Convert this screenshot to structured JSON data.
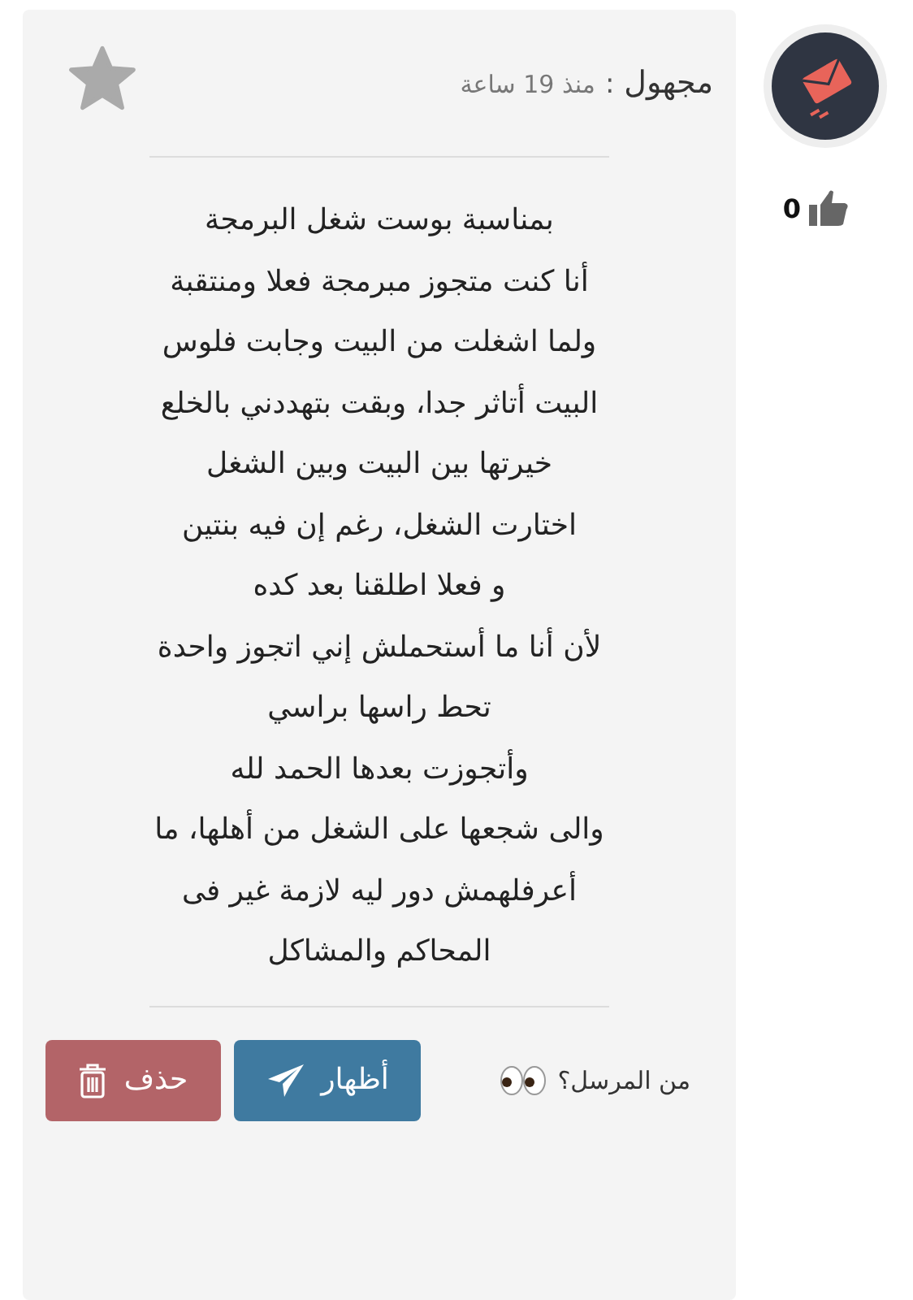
{
  "author": {
    "name": "مجهول",
    "separator": ":",
    "time": "منذ 19 ساعة"
  },
  "likes": {
    "count": "0"
  },
  "message": {
    "lines": [
      "بمناسبة بوست شغل البرمجة",
      "أنا كنت متجوز مبرمجة فعلا ومنتقبة",
      "ولما اشغلت من البيت وجابت فلوس",
      "البيت أتاثر جدا، وبقت بتهددني بالخلع",
      "خيرتها بين البيت وبين الشغل",
      "اختارت الشغل، رغم إن فيه بنتين",
      "و فعلا اطلقنا بعد كده",
      "لأن أنا ما أستحملش إني اتجوز واحدة",
      "تحط راسها براسي",
      "وأتجوزت بعدها الحمد لله",
      "والى شجعها على الشغل من أهلها، ما",
      "أعرفلهمش دور ليه لازمة غير فى",
      "المحاكم والمشاكل"
    ]
  },
  "footer": {
    "question": "من المرسل؟",
    "buttons": [
      {
        "label": "أظهار",
        "kind": "reveal"
      },
      {
        "label": "حذف",
        "kind": "delete"
      }
    ]
  }
}
